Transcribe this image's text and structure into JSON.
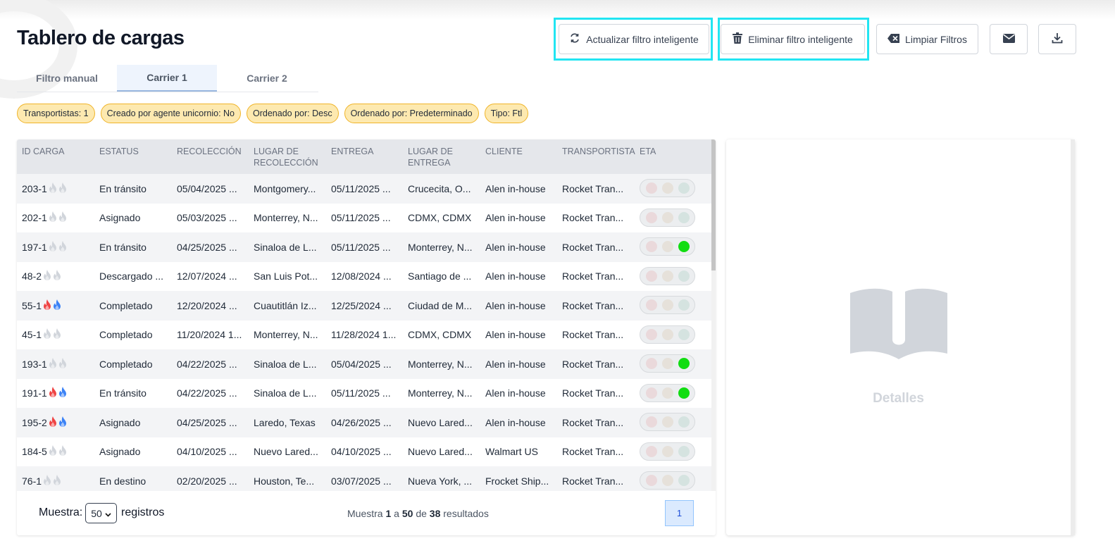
{
  "page": {
    "title": "Tablero de cargas"
  },
  "toolbar": {
    "update_smart": "Actualizar filtro inteligente",
    "delete_smart": "Eliminar filtro inteligente",
    "clear_filters": "Limpiar Filtros"
  },
  "tabs": [
    "Filtro manual",
    "Carrier 1",
    "Carrier 2"
  ],
  "active_tab": "Carrier 1",
  "chips": [
    "Transportistas: 1",
    "Creado por agente unicornio: No",
    "Ordenado por: Desc",
    "Ordenado por: Predeterminado",
    "Tipo: Ftl"
  ],
  "columns": [
    "ID CARGA",
    "ESTATUS",
    "RECOLECCIÓN",
    "LUGAR DE RECOLECCIÓN",
    "ENTREGA",
    "LUGAR DE ENTREGA",
    "CLIENTE",
    "TRANSPORTISTA",
    "ETA"
  ],
  "rows": [
    {
      "id": "203-1",
      "hot": false,
      "status": "En tránsito",
      "pickup": "05/04/2025 ...",
      "pickup_place": "Montgomery...",
      "delivery": "05/11/2025 ...",
      "delivery_place": "Crucecita, O...",
      "client": "Alen in-house",
      "carrier": "Rocket Tran...",
      "eta_green": false
    },
    {
      "id": "202-1",
      "hot": false,
      "status": "Asignado",
      "pickup": "05/03/2025 ...",
      "pickup_place": "Monterrey, N...",
      "delivery": "05/11/2025 ...",
      "delivery_place": "CDMX, CDMX",
      "client": "Alen in-house",
      "carrier": "Rocket Tran...",
      "eta_green": false
    },
    {
      "id": "197-1",
      "hot": false,
      "status": "En tránsito",
      "pickup": "04/25/2025 ...",
      "pickup_place": "Sinaloa de L...",
      "delivery": "05/11/2025 ...",
      "delivery_place": "Monterrey, N...",
      "client": "Alen in-house",
      "carrier": "Rocket Tran...",
      "eta_green": true
    },
    {
      "id": "48-2",
      "hot": false,
      "status": "Descargado ...",
      "pickup": "12/07/2024 ...",
      "pickup_place": "San Luis Pot...",
      "delivery": "12/08/2024 ...",
      "delivery_place": "Santiago de ...",
      "client": "Alen in-house",
      "carrier": "Rocket Tran...",
      "eta_green": false
    },
    {
      "id": "55-1",
      "hot": true,
      "status": "Completado",
      "pickup": "12/20/2024 ...",
      "pickup_place": "Cuautitlán Iz...",
      "delivery": "12/25/2024 ...",
      "delivery_place": "Ciudad de M...",
      "client": "Alen in-house",
      "carrier": "Rocket Tran...",
      "eta_green": false
    },
    {
      "id": "45-1",
      "hot": false,
      "status": "Completado",
      "pickup": "11/20/2024 1...",
      "pickup_place": "Monterrey, N...",
      "delivery": "11/28/2024 1...",
      "delivery_place": "CDMX, CDMX",
      "client": "Alen in-house",
      "carrier": "Rocket Tran...",
      "eta_green": false
    },
    {
      "id": "193-1",
      "hot": false,
      "status": "Completado",
      "pickup": "04/22/2025 ...",
      "pickup_place": "Sinaloa de L...",
      "delivery": "05/04/2025 ...",
      "delivery_place": "Monterrey, N...",
      "client": "Alen in-house",
      "carrier": "Rocket Tran...",
      "eta_green": true
    },
    {
      "id": "191-1",
      "hot": true,
      "status": "En tránsito",
      "pickup": "04/22/2025 ...",
      "pickup_place": "Sinaloa de L...",
      "delivery": "05/11/2025 ...",
      "delivery_place": "Monterrey, N...",
      "client": "Alen in-house",
      "carrier": "Rocket Tran...",
      "eta_green": true
    },
    {
      "id": "195-2",
      "hot": true,
      "status": "Asignado",
      "pickup": "04/25/2025 ...",
      "pickup_place": "Laredo, Texas",
      "delivery": "04/26/2025 ...",
      "delivery_place": "Nuevo Lared...",
      "client": "Alen in-house",
      "carrier": "Rocket Tran...",
      "eta_green": false
    },
    {
      "id": "184-5",
      "hot": false,
      "status": "Asignado",
      "pickup": "04/10/2025 ...",
      "pickup_place": "Nuevo Lared...",
      "delivery": "04/10/2025 ...",
      "delivery_place": "Nuevo Lared...",
      "client": "Walmart US",
      "carrier": "Rocket Tran...",
      "eta_green": false
    },
    {
      "id": "76-1",
      "hot": false,
      "status": "En destino",
      "pickup": "02/20/2025 ...",
      "pickup_place": "Houston, Te...",
      "delivery": "03/07/2025 ...",
      "delivery_place": "Nueva York, ...",
      "client": "Frocket Ship...",
      "carrier": "Rocket Tran...",
      "eta_green": false
    }
  ],
  "pagination": {
    "show_label": "Muestra:",
    "page_size": "50",
    "records_label": "registros",
    "summary_prefix": "Muestra",
    "from": "1",
    "to_word": "a",
    "to": "50",
    "of_word": "de",
    "total": "38",
    "suffix": "resultados",
    "current_page": "1"
  },
  "details": {
    "label": "Detalles"
  },
  "colors": {
    "highlight": "#22e5f2",
    "chip_bg": "#fde9b0",
    "chip_border": "#f0b429",
    "eta_green": "#11dd11",
    "flame_red": "#ef4444",
    "flame_blue": "#3b82f6",
    "flame_gray": "#d1d5db"
  }
}
